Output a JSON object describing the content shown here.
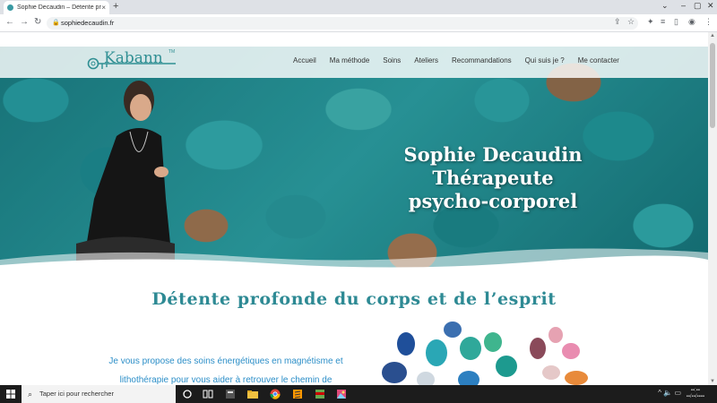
{
  "browser": {
    "tab_title": "Sophie Decaudin – Détente prof",
    "tab_close": "×",
    "new_tab": "+",
    "url": "sophiedecaudin.fr",
    "icons": [
      "back-arrow-icon",
      "forward-arrow-icon",
      "reload-icon",
      "lock-icon",
      "share-icon",
      "bookmark-star-icon",
      "extensions-icon",
      "reading-list-icon",
      "side-panel-icon",
      "profile-icon",
      "more-icon"
    ]
  },
  "nav": {
    "logo_text": "Kabann",
    "logo_tm": "TM",
    "items": [
      "Accueil",
      "Ma méthode",
      "Soins",
      "Ateliers",
      "Recommandations",
      "Qui suis je ?",
      "Me contacter"
    ]
  },
  "hero": {
    "line1": "Sophie Decaudin",
    "line2": "Thérapeute",
    "line3": "psycho-corporel"
  },
  "main": {
    "subtitle": "Détente profonde du corps et de l’esprit",
    "intro_line1": "Je vous propose des soins énergétiques en magnétisme et",
    "intro_line2": "lithothérapie pour vous aider à retrouver le chemin de"
  },
  "taskbar": {
    "search_placeholder": "Taper ici pour rechercher"
  },
  "colors": {
    "accent": "#2e8a94",
    "intro_text": "#2d8fc8",
    "taskbar": "#1c1c1c"
  }
}
